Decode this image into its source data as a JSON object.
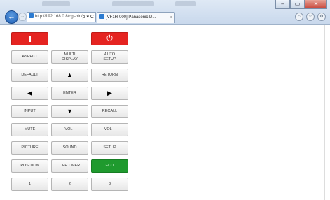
{
  "browser": {
    "address_url": "http://192.168.0.8/cgi-bin/r",
    "address_controls": "ρ ▾ C",
    "tab_title": "[VF1H-000] Panasonic D...",
    "tab_close": "×",
    "back_arrow": "←",
    "forward_arrow": "→",
    "window_buttons": [
      "–",
      "▭",
      "✕"
    ],
    "tool_icons": [
      "home-icon",
      "star-icon",
      "gear-icon"
    ],
    "tool_glyphs": [
      "⌂",
      "☆",
      "⚙"
    ]
  },
  "remote": {
    "power_off_label": "|",
    "power_on_label": "⏻",
    "aspect": "ASPECT",
    "multi_display": "MULTI\nDISPLAY",
    "auto_setup": "AUTO\nSETUP",
    "default": "DEFAULT",
    "up": "▲",
    "return": "RETURN",
    "left": "◀",
    "enter": "ENTER",
    "right": "▶",
    "input": "INPUT",
    "down": "▼",
    "recall": "RECALL",
    "mute": "MUTE",
    "vol_minus": "VOL -",
    "vol_plus": "VOL +",
    "picture": "PICTURE",
    "sound": "SOUND",
    "setup": "SETUP",
    "position": "POSITION",
    "off_timer": "OFF TIMER",
    "eco": "ECO",
    "num_1": "1",
    "num_2": "2",
    "num_3": "3"
  },
  "colors": {
    "power_red": "#e52421",
    "eco_green": "#1f9a2e"
  }
}
